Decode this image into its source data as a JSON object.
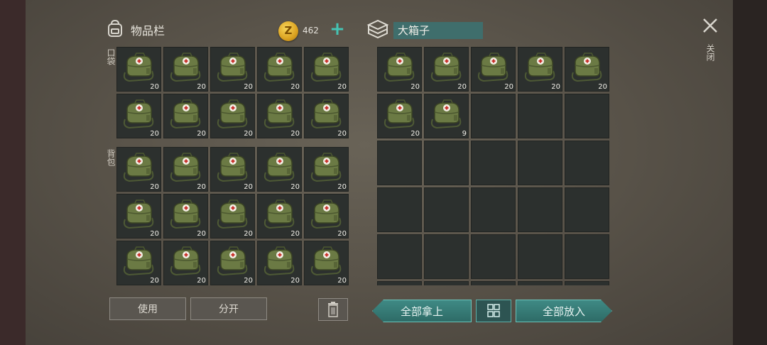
{
  "inventory": {
    "title": "物品栏",
    "coins": "462",
    "pocket_label": "口袋",
    "backpack_label": "背包",
    "pocket_slots": [
      {
        "item": "medkit-bag",
        "qty": "20"
      },
      {
        "item": "medkit-bag",
        "qty": "20"
      },
      {
        "item": "medkit-bag",
        "qty": "20"
      },
      {
        "item": "medkit-bag",
        "qty": "20"
      },
      {
        "item": "medkit-bag",
        "qty": "20"
      },
      {
        "item": "medkit-bag",
        "qty": "20"
      },
      {
        "item": "medkit-bag",
        "qty": "20"
      },
      {
        "item": "medkit-bag",
        "qty": "20"
      },
      {
        "item": "medkit-bag",
        "qty": "20"
      },
      {
        "item": "medkit-bag",
        "qty": "20"
      }
    ],
    "backpack_slots": [
      {
        "item": "medkit-bag",
        "qty": "20"
      },
      {
        "item": "medkit-bag",
        "qty": "20"
      },
      {
        "item": "medkit-bag",
        "qty": "20"
      },
      {
        "item": "medkit-bag",
        "qty": "20"
      },
      {
        "item": "medkit-bag",
        "qty": "20"
      },
      {
        "item": "medkit-bag",
        "qty": "20"
      },
      {
        "item": "medkit-bag",
        "qty": "20"
      },
      {
        "item": "medkit-bag",
        "qty": "20"
      },
      {
        "item": "medkit-bag",
        "qty": "20"
      },
      {
        "item": "medkit-bag",
        "qty": "20"
      },
      {
        "item": "medkit-bag",
        "qty": "20"
      },
      {
        "item": "medkit-bag",
        "qty": "20"
      },
      {
        "item": "medkit-bag",
        "qty": "20"
      },
      {
        "item": "medkit-bag",
        "qty": "20"
      },
      {
        "item": "medkit-bag",
        "qty": "20"
      }
    ],
    "use_label": "使用",
    "split_label": "分开"
  },
  "container": {
    "title": "大箱子",
    "slots": [
      {
        "item": "medkit-bag",
        "qty": "20"
      },
      {
        "item": "medkit-bag",
        "qty": "20"
      },
      {
        "item": "medkit-bag",
        "qty": "20"
      },
      {
        "item": "medkit-bag",
        "qty": "20"
      },
      {
        "item": "medkit-bag",
        "qty": "20"
      },
      {
        "item": "medkit-bag",
        "qty": "20"
      },
      {
        "item": "medkit-bag",
        "qty": "9"
      },
      {
        "item": "",
        "qty": ""
      },
      {
        "item": "",
        "qty": ""
      },
      {
        "item": "",
        "qty": ""
      },
      {
        "item": "",
        "qty": ""
      },
      {
        "item": "",
        "qty": ""
      },
      {
        "item": "",
        "qty": ""
      },
      {
        "item": "",
        "qty": ""
      },
      {
        "item": "",
        "qty": ""
      },
      {
        "item": "",
        "qty": ""
      },
      {
        "item": "",
        "qty": ""
      },
      {
        "item": "",
        "qty": ""
      },
      {
        "item": "",
        "qty": ""
      },
      {
        "item": "",
        "qty": ""
      },
      {
        "item": "",
        "qty": ""
      },
      {
        "item": "",
        "qty": ""
      },
      {
        "item": "",
        "qty": ""
      },
      {
        "item": "",
        "qty": ""
      },
      {
        "item": "",
        "qty": ""
      },
      {
        "item": "",
        "qty": ""
      },
      {
        "item": "",
        "qty": ""
      },
      {
        "item": "",
        "qty": ""
      },
      {
        "item": "",
        "qty": ""
      },
      {
        "item": "",
        "qty": ""
      }
    ],
    "take_all_label": "全部拿上",
    "put_all_label": "全部放入"
  },
  "close_label": "关闭",
  "icons": {
    "backpack": "backpack-icon",
    "coin": "coin-icon",
    "add": "plus-icon",
    "box": "box-icon",
    "close": "close-icon",
    "trash": "trash-icon",
    "sort": "grid-sort-icon"
  },
  "colors": {
    "accent_teal": "#3f8a85",
    "slot_bg": "#2c302e",
    "title_field": "#3f6e6c"
  }
}
